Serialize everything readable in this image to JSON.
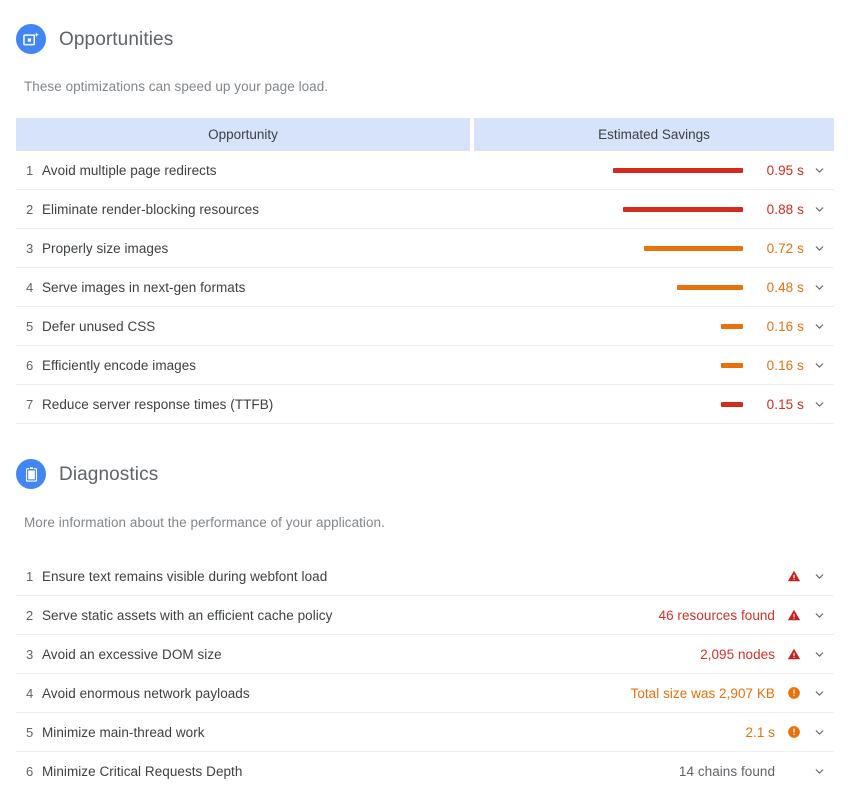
{
  "opportunities": {
    "icon": "opportunity-image-icon",
    "title": "Opportunities",
    "description": "These optimizations can speed up your page load.",
    "columns": {
      "opportunity": "Opportunity",
      "savings": "Estimated Savings"
    },
    "rows": [
      {
        "rank": "1",
        "title": "Avoid multiple page redirects",
        "value": "0.95 s",
        "seconds": 0.95,
        "color": "#d52b1e"
      },
      {
        "rank": "2",
        "title": "Eliminate render-blocking resources",
        "value": "0.88 s",
        "seconds": 0.88,
        "color": "#d52b1e"
      },
      {
        "rank": "3",
        "title": "Properly size images",
        "value": "0.72 s",
        "seconds": 0.72,
        "color": "#e8710a"
      },
      {
        "rank": "4",
        "title": "Serve images in next-gen formats",
        "value": "0.48 s",
        "seconds": 0.48,
        "color": "#e8710a"
      },
      {
        "rank": "5",
        "title": "Defer unused CSS",
        "value": "0.16 s",
        "seconds": 0.16,
        "color": "#e8710a"
      },
      {
        "rank": "6",
        "title": "Efficiently encode images",
        "value": "0.16 s",
        "seconds": 0.16,
        "color": "#e8710a"
      },
      {
        "rank": "7",
        "title": "Reduce server response times (TTFB)",
        "value": "0.15 s",
        "seconds": 0.15,
        "color": "#d52b1e"
      }
    ],
    "expand_icon": "chevron-down-icon"
  },
  "diagnostics": {
    "icon": "clipboard-icon",
    "title": "Diagnostics",
    "description": "More information about the performance of your application.",
    "rows": [
      {
        "rank": "1",
        "title": "Ensure text remains visible during webfont load",
        "value": "",
        "severity": "warning-triangle-icon",
        "color": "#d93025"
      },
      {
        "rank": "2",
        "title": "Serve static assets with an efficient cache policy",
        "value": "46 resources found",
        "severity": "warning-triangle-icon",
        "color": "#d93025"
      },
      {
        "rank": "3",
        "title": "Avoid an excessive DOM size",
        "value": "2,095 nodes",
        "severity": "warning-triangle-icon",
        "color": "#d93025"
      },
      {
        "rank": "4",
        "title": "Avoid enormous network payloads",
        "value": "Total size was 2,907 KB",
        "severity": "info-circle-icon",
        "color": "#e8710a"
      },
      {
        "rank": "5",
        "title": "Minimize main-thread work",
        "value": "2.1 s",
        "severity": "info-circle-icon",
        "color": "#e8710a"
      },
      {
        "rank": "6",
        "title": "Minimize Critical Requests Depth",
        "value": "14 chains found",
        "severity": "none",
        "color": "#5f6368"
      }
    ],
    "expand_icon": "chevron-down-icon"
  },
  "theme": {
    "accent_blue": "#4285f4",
    "header_bg": "#d6e3fb",
    "red": "#d93025",
    "orange": "#e8710a",
    "text": "#3c4043",
    "muted": "#80868b"
  }
}
